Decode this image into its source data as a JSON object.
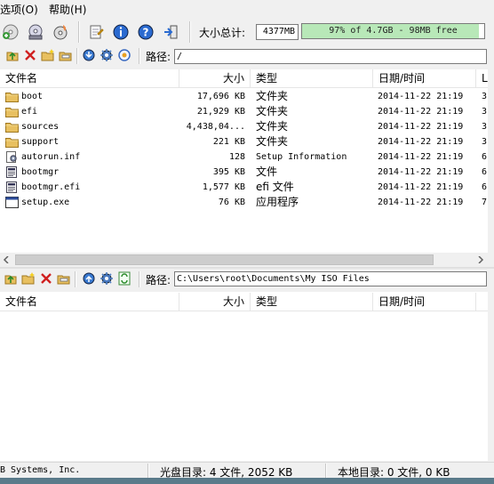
{
  "menu": {
    "items": [
      {
        "label": "选项(O)"
      },
      {
        "label": "帮助(H)"
      }
    ]
  },
  "toolbar": {
    "size_label": "大小总计:",
    "size_value": "4377MB",
    "free_text": "97% of 4.7GB - 98MB free",
    "free_fraction": 0.97
  },
  "top_pane": {
    "path_label": "路径:",
    "path_value": "/",
    "columns": [
      "文件名",
      "大小",
      "类型",
      "日期/时间",
      "L"
    ],
    "rows": [
      {
        "name": "boot",
        "size": "17,696 KB",
        "type": "文件夹",
        "date": "2014-11-22 21:19",
        "extra": "3",
        "icon": "folder-icon"
      },
      {
        "name": "efi",
        "size": "21,929 KB",
        "type": "文件夹",
        "date": "2014-11-22 21:19",
        "extra": "3",
        "icon": "folder-icon"
      },
      {
        "name": "sources",
        "size": "4,438,04...",
        "type": "文件夹",
        "date": "2014-11-22 21:19",
        "extra": "3",
        "icon": "folder-icon"
      },
      {
        "name": "support",
        "size": "221 KB",
        "type": "文件夹",
        "date": "2014-11-22 21:19",
        "extra": "3",
        "icon": "folder-icon"
      },
      {
        "name": "autorun.inf",
        "size": "128",
        "type": "Setup Information",
        "date": "2014-11-22 21:19",
        "extra": "6",
        "icon": "settings-file-icon"
      },
      {
        "name": "bootmgr",
        "size": "395 KB",
        "type": "文件",
        "date": "2014-11-22 21:19",
        "extra": "6",
        "icon": "file-icon"
      },
      {
        "name": "bootmgr.efi",
        "size": "1,577 KB",
        "type": "efi 文件",
        "date": "2014-11-22 21:19",
        "extra": "6",
        "icon": "file-icon"
      },
      {
        "name": "setup.exe",
        "size": "76 KB",
        "type": "应用程序",
        "date": "2014-11-22 21:19",
        "extra": "7",
        "icon": "application-icon"
      }
    ]
  },
  "bottom_pane": {
    "path_label": "路径:",
    "path_value": "C:\\Users\\root\\Documents\\My ISO Files",
    "columns": [
      "文件名",
      "大小",
      "类型",
      "日期/时间"
    ]
  },
  "status": {
    "left": "B Systems, Inc.",
    "middle": "光盘目录: 4 文件, 2052 KB",
    "right": "本地目录: 0 文件, 0 KB"
  },
  "colors": {
    "free_bar_fill": "#b8e8b8",
    "folder": "#e8c060"
  }
}
